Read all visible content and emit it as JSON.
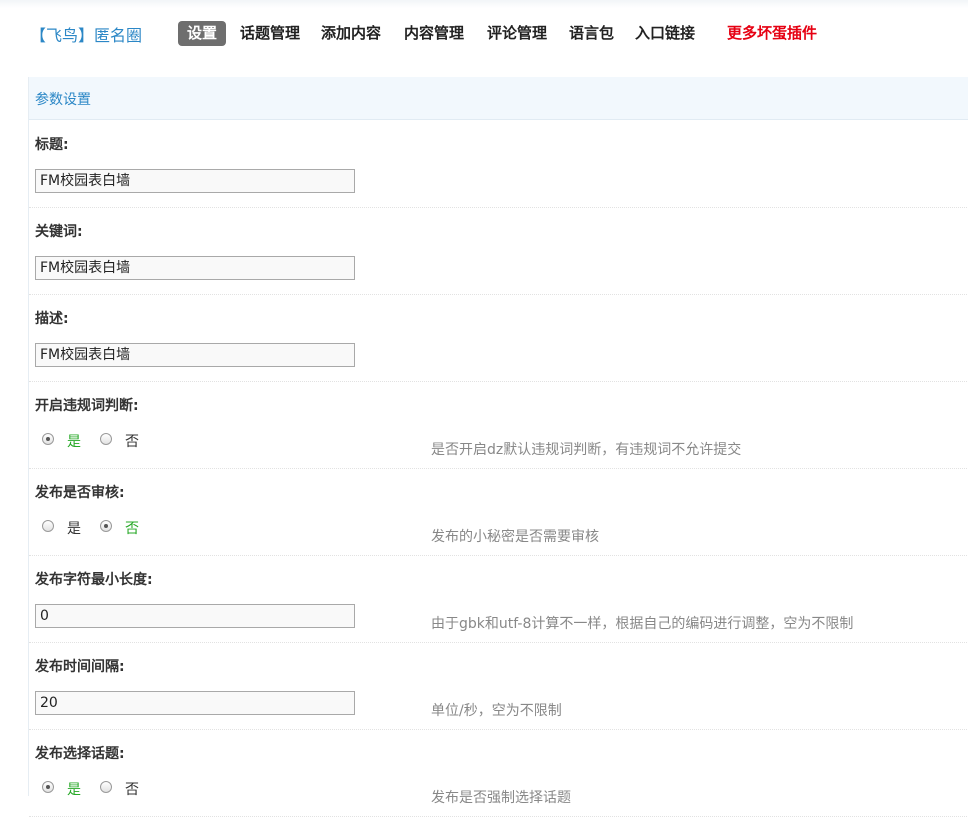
{
  "brand": {
    "text": "【飞鸟】匿名圈",
    "color": "#2b87c6"
  },
  "nav": {
    "items": [
      {
        "label": "设置",
        "active": true
      },
      {
        "label": "话题管理"
      },
      {
        "label": "添加内容"
      },
      {
        "label": "内容管理"
      },
      {
        "label": "评论管理"
      },
      {
        "label": "语言包"
      },
      {
        "label": "入口链接"
      },
      {
        "label": "更多坏蛋插件",
        "special": true
      }
    ],
    "active_bg": "#6e6e6e",
    "special_color": "#e60012"
  },
  "panel": {
    "title": "参数设置",
    "fields": [
      {
        "label": "标题:",
        "value": "FM校园表白墙"
      },
      {
        "label": "关键词:",
        "value": "FM校园表白墙"
      },
      {
        "label": "描述:",
        "value": "FM校园表白墙"
      },
      {
        "label": "开启违规词判断:",
        "options": [
          "是",
          "否"
        ],
        "selected": "是",
        "hint": "是否开启dz默认违规词判断，有违规词不允许提交"
      },
      {
        "label": "发布是否审核:",
        "options": [
          "是",
          "否"
        ],
        "selected": "否",
        "hint": "发布的小秘密是否需要审核"
      },
      {
        "label": "发布字符最小长度:",
        "value": "0",
        "hint": "由于gbk和utf-8计算不一样，根据自己的编码进行调整，空为不限制"
      },
      {
        "label": "发布时间间隔:",
        "value": "20",
        "hint": "单位/秒，空为不限制"
      },
      {
        "label": "发布选择话题:",
        "options": [
          "是",
          "否"
        ],
        "selected": "是",
        "hint": "发布是否强制选择话题"
      }
    ]
  },
  "colors": {
    "accent": "#2b87c6",
    "selected_option": "#27a827",
    "hint": "#888888"
  }
}
